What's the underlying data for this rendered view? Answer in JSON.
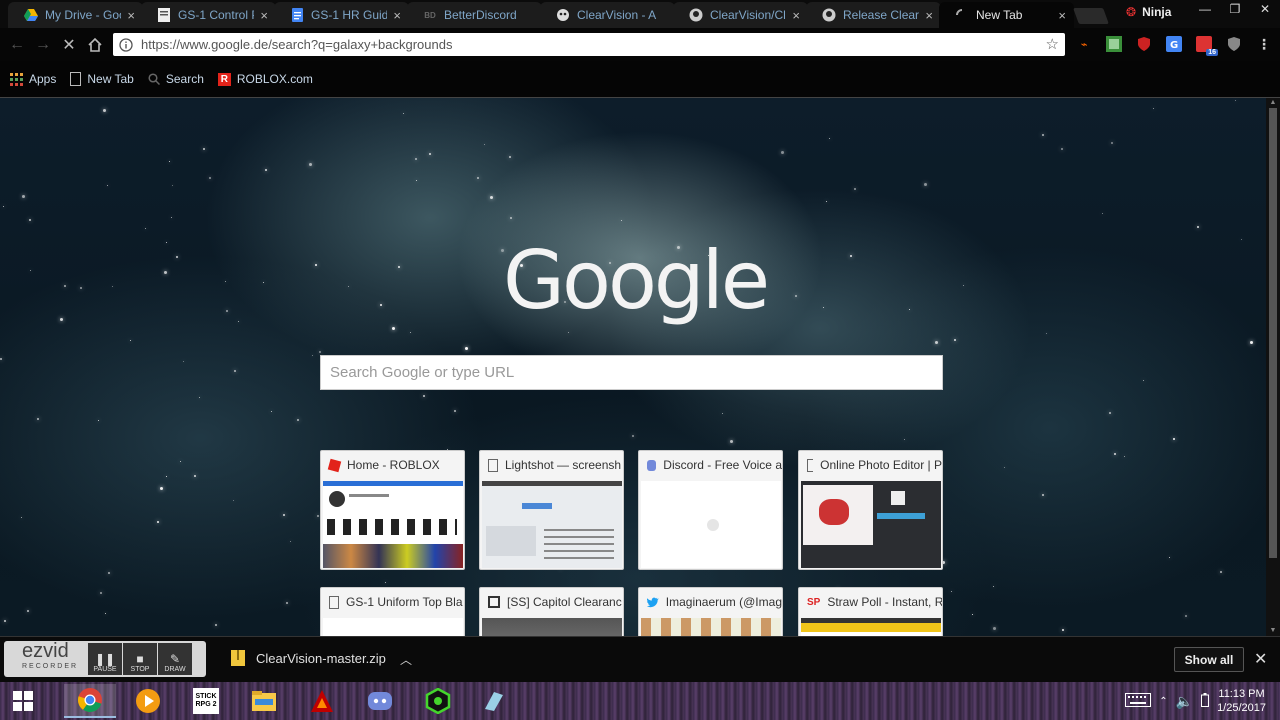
{
  "browser": {
    "tabs": [
      {
        "label": "My Drive - Goo",
        "icon": "google-drive-icon"
      },
      {
        "label": "GS-1 Control P",
        "icon": "document-icon"
      },
      {
        "label": "GS-1 HR Guide",
        "icon": "google-docs-icon"
      },
      {
        "label": "BetterDiscord",
        "icon": "betterdiscord-icon"
      },
      {
        "label": "ClearVision - A",
        "icon": "clearvision-icon"
      },
      {
        "label": "ClearVision/Cle",
        "icon": "github-icon"
      },
      {
        "label": "Release ClearV",
        "icon": "github-icon"
      },
      {
        "label": "New Tab",
        "icon": "loading-icon",
        "active": true
      }
    ],
    "tab_close": "×",
    "profile_name": "Ninja",
    "window_buttons": {
      "minimize": "—",
      "restore": "❐",
      "close": "✕"
    },
    "url": "https://www.google.de/search?q=galaxy+backgrounds",
    "star": "☆",
    "extensions": [
      "extension-orange-icon",
      "extension-green-icon",
      "ublock-icon",
      "google-translate-icon",
      "extension-red-badge-icon",
      "shield-icon",
      "menu-icon"
    ],
    "extension_badge": "16"
  },
  "bookmarks": [
    {
      "label": "Apps",
      "icon": "apps-grid-icon"
    },
    {
      "label": "New Tab",
      "icon": "page-icon"
    },
    {
      "label": "Search",
      "icon": "search-icon"
    },
    {
      "label": "ROBLOX.com",
      "icon": "roblox-icon"
    }
  ],
  "newtab": {
    "logo": "Google",
    "search_placeholder": "Search Google or type URL",
    "tiles": [
      {
        "title": "Home - ROBLOX",
        "icon": "roblox-icon"
      },
      {
        "title": "Lightshot — screensh",
        "icon": "page-icon"
      },
      {
        "title": "Discord - Free Voice a",
        "icon": "discord-icon"
      },
      {
        "title": "Online Photo Editor | P",
        "icon": "page-icon"
      },
      {
        "title": "GS-1 Uniform Top Bla",
        "icon": "page-icon"
      },
      {
        "title": "[SS] Capitol Clearanc",
        "icon": "trello-icon"
      },
      {
        "title": "Imaginaerum (@Imag",
        "icon": "twitter-icon"
      },
      {
        "title": "Straw Poll - Instant, R",
        "icon": "strawpoll-icon"
      }
    ]
  },
  "shelf": {
    "ezvid_brand": "ezvid",
    "ezvid_sub": "RECORDER",
    "ezvid_controls": [
      "PAUSE",
      "STOP",
      "DRAW"
    ],
    "download_file": "ClearVision-master.zip",
    "show_all": "Show all",
    "close": "✕"
  },
  "taskbar": {
    "apps": [
      "windows-start-icon",
      "chrome-icon",
      "media-player-icon",
      "stick-rpg-icon",
      "file-explorer-icon",
      "filezilla-icon",
      "discord-icon",
      "razer-icon",
      "app-icon"
    ],
    "stick_rpg_label": "STICK RPG 2",
    "time": "11:13 PM",
    "date": "1/25/2017"
  }
}
